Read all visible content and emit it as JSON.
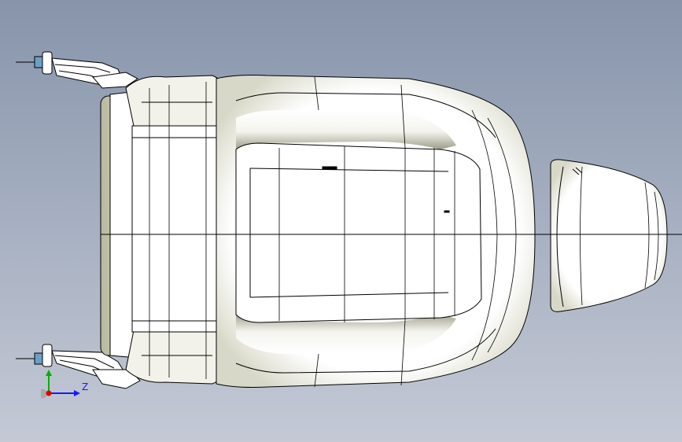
{
  "viewport": {
    "background_top": "#8794aa",
    "background_bottom": "#c4c9d5"
  },
  "model": {
    "part": "seat-assembly-top-view",
    "surface_color": "#ffffff",
    "shadow_color": "#bdbfa6",
    "edge_color": "#000000"
  },
  "triad": {
    "z_label": "Z",
    "y_axis_color": "#00b000",
    "z_axis_color": "#1a1aff",
    "x_axis_color": "#e00000"
  }
}
